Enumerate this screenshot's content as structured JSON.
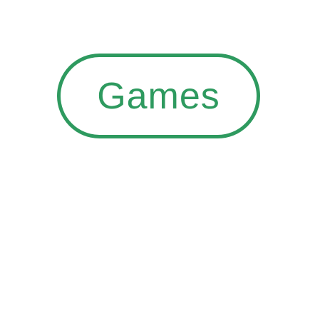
{
  "chip": {
    "label": "Games",
    "accent_color": "#2e9a5f"
  }
}
